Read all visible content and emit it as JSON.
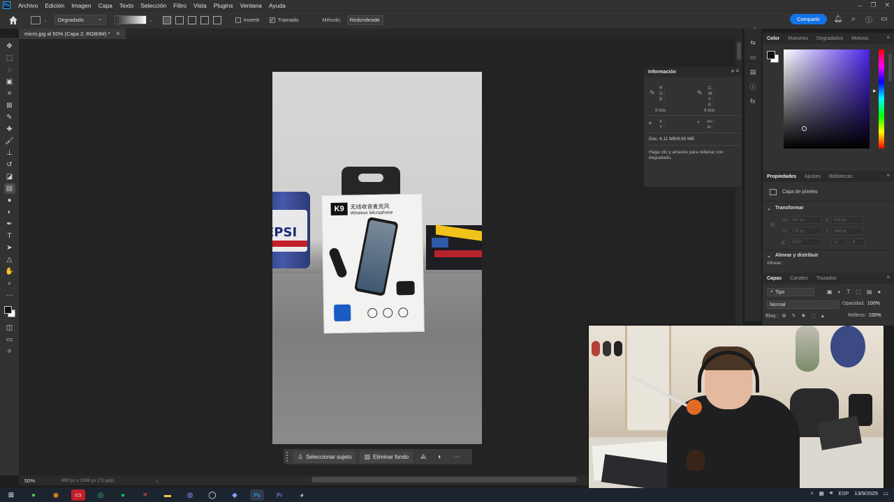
{
  "menubar": {
    "logo": "Ps",
    "items": [
      "Archivo",
      "Edición",
      "Imagen",
      "Capa",
      "Texto",
      "Selección",
      "Filtro",
      "Vista",
      "Plugins",
      "Ventana",
      "Ayuda"
    ]
  },
  "options": {
    "preset": "Degradado",
    "invertir": "Invertir",
    "tramado": "Tramado",
    "metodo_label": "Método:",
    "metodo_value": "Redondeado",
    "share": "Compartir"
  },
  "document": {
    "tab_title": "micro.jpg al 50% (Capa 2, RGB/8#) *",
    "zoom": "50%",
    "size_info": "899 px x 1599 px (72 ppp)"
  },
  "context_bar": {
    "select_subject": "Seleccionar sujeto",
    "remove_bg": "Eliminar fondo"
  },
  "photo": {
    "box_brand": "K9",
    "box_cn": "无线收音麦克风",
    "box_en": "Wireless Microphone",
    "can_text": "EPSI"
  },
  "info_panel": {
    "title": "Información",
    "rgb": [
      "R :",
      "G :",
      "B :"
    ],
    "cmyk": [
      "C :",
      "M :",
      "Y :",
      "K :"
    ],
    "bits_left": "8 bits",
    "bits_right": "8 bits",
    "xy": [
      "X :",
      "Y :"
    ],
    "wh": [
      "An :",
      "Al :"
    ],
    "doc": "Doc: 4,11 MB/9,60 MB",
    "hint": "Haga clic y arrastre para rellenar con degradado."
  },
  "color_panel": {
    "tabs": [
      "Color",
      "Muestras",
      "Degradados",
      "Motivos"
    ],
    "fg": "#111111",
    "bg": "#ffffff"
  },
  "properties_panel": {
    "tabs": [
      "Propiedades",
      "Ajustes",
      "Bibliotecas"
    ],
    "layer_type": "Capa de píxeles",
    "transform": "Transformar",
    "fields": {
      "w": "442 px",
      "h": "716 px",
      "x": "214 px",
      "y": "468 px",
      "angle": "0,00°",
      "an_label": "An",
      "al_label": "Al",
      "x_label": "X",
      "y_label": "Y"
    },
    "align": "Alinear y distribuir",
    "align_label": "Alinear:"
  },
  "layers_panel": {
    "tabs": [
      "Capas",
      "Canales",
      "Trazados"
    ],
    "kind": "Tipo",
    "blend": "Normal",
    "opacity_label": "Opacidad:",
    "opacity": "100%",
    "lock_label": "Bloq.:",
    "fill_label": "Relleno:",
    "fill": "100%"
  },
  "taskbar": {
    "lang": "ESP",
    "date": "13/9/2025"
  },
  "colors": {
    "accent": "#1473e6",
    "panel": "#323232",
    "workspace": "#232323"
  }
}
